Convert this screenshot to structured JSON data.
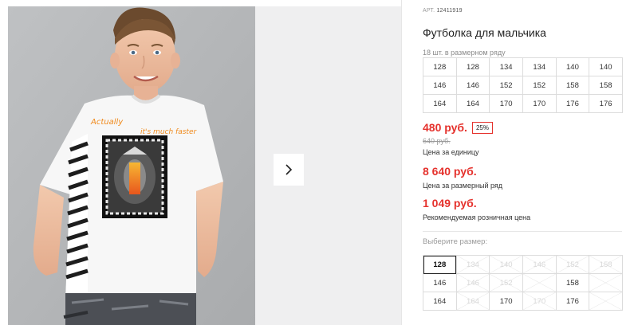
{
  "colors": {
    "accent_red": "#e5322d",
    "photo_bg": "#b4b6b8",
    "panel_bg": "#efeff0",
    "border": "#dcdcdc"
  },
  "gallery": {
    "next_icon": "chevron-right-icon",
    "shirt_print_text": "Actually it's much faster"
  },
  "product": {
    "article_label": "АРТ.",
    "article_code": "12411919",
    "title": "Футболка для мальчика",
    "pack_note": "18 шт. в размерном ряду",
    "pack_sizes": [
      [
        "128",
        "128",
        "134",
        "134",
        "140",
        "140"
      ],
      [
        "146",
        "146",
        "152",
        "152",
        "158",
        "158"
      ],
      [
        "164",
        "164",
        "170",
        "170",
        "176",
        "176"
      ]
    ]
  },
  "pricing": {
    "unit_price": "480 руб.",
    "discount": "25%",
    "old_price": "640 руб.",
    "unit_label": "Цена за единицу",
    "pack_price": "8 640 руб.",
    "pack_label": "Цена за размерный ряд",
    "retail_price": "1 049 руб.",
    "retail_label": "Рекомендуемая розничная цена"
  },
  "size_picker": {
    "label": "Выберите размер:",
    "rows": [
      [
        {
          "size": "128",
          "state": "selected"
        },
        {
          "size": "134",
          "state": "disabled"
        },
        {
          "size": "140",
          "state": "disabled"
        },
        {
          "size": "146",
          "state": "disabled"
        },
        {
          "size": "152",
          "state": "disabled"
        },
        {
          "size": "158",
          "state": "disabled"
        }
      ],
      [
        {
          "size": "146",
          "state": "available"
        },
        {
          "size": "146",
          "state": "disabled"
        },
        {
          "size": "152",
          "state": "disabled"
        },
        {
          "size": "",
          "state": "disabled"
        },
        {
          "size": "158",
          "state": "available"
        },
        {
          "size": "",
          "state": "disabled"
        }
      ],
      [
        {
          "size": "164",
          "state": "available"
        },
        {
          "size": "164",
          "state": "disabled"
        },
        {
          "size": "170",
          "state": "available"
        },
        {
          "size": "170",
          "state": "disabled"
        },
        {
          "size": "176",
          "state": "available"
        },
        {
          "size": "",
          "state": "disabled"
        }
      ]
    ]
  }
}
